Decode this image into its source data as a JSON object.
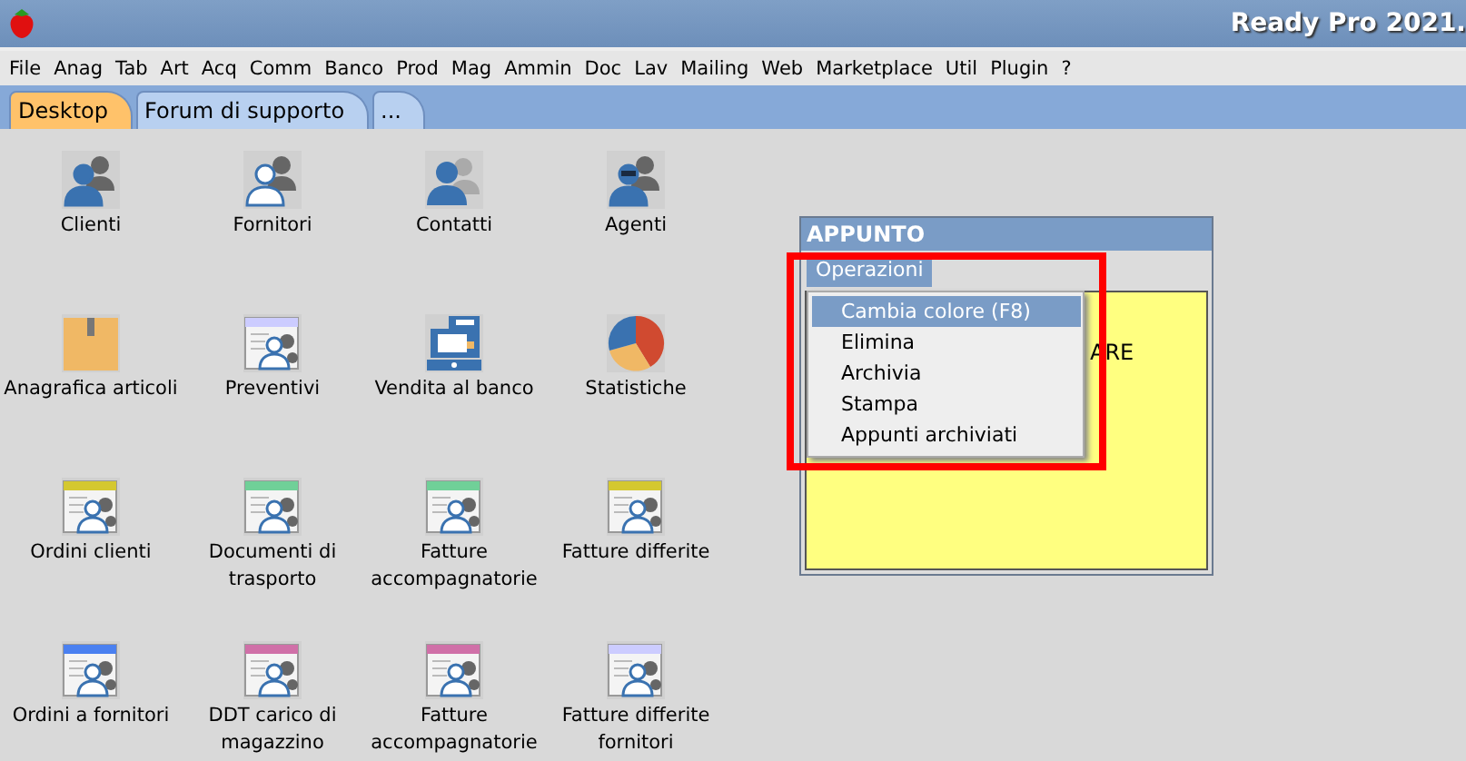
{
  "window": {
    "title": "Ready Pro 2021."
  },
  "menu": [
    "File",
    "Anag",
    "Tab",
    "Art",
    "Acq",
    "Comm",
    "Banco",
    "Prod",
    "Mag",
    "Ammin",
    "Doc",
    "Lav",
    "Mailing",
    "Web",
    "Marketplace",
    "Util",
    "Plugin",
    "?"
  ],
  "tabs": [
    {
      "label": "Desktop",
      "selected": true
    },
    {
      "label": "Forum di supporto",
      "selected": false
    },
    {
      "label": "...",
      "selected": false
    }
  ],
  "desktop_items": [
    {
      "label": "Clienti",
      "kind": "person"
    },
    {
      "label": "Fornitori",
      "kind": "person2"
    },
    {
      "label": "Contatti",
      "kind": "contact"
    },
    {
      "label": "Agenti",
      "kind": "agent"
    },
    {
      "label": "Anagrafica articoli",
      "kind": "box"
    },
    {
      "label": "Preventivi",
      "kind": "doc",
      "color": "#ccccff"
    },
    {
      "label": "Vendita al banco",
      "kind": "register"
    },
    {
      "label": "Statistiche",
      "kind": "pie"
    },
    {
      "label": "Ordini clienti",
      "kind": "doc",
      "color": "#d4c830"
    },
    {
      "label": "Documenti di trasporto",
      "kind": "doc",
      "color": "#70d098"
    },
    {
      "label": "Fatture accompagnatorie",
      "kind": "doc",
      "color": "#70d098"
    },
    {
      "label": "Fatture differite",
      "kind": "doc",
      "color": "#d4c830"
    },
    {
      "label": "Ordini a fornitori",
      "kind": "doc",
      "color": "#4a80f0"
    },
    {
      "label": "DDT carico di magazzino",
      "kind": "doc",
      "color": "#d070a8"
    },
    {
      "label": "Fatture accompagnatorie",
      "kind": "doc",
      "color": "#d070a8"
    },
    {
      "label": "Fatture differite fornitori",
      "kind": "doc",
      "color": "#ccccff"
    }
  ],
  "note": {
    "title": "APPUNTO",
    "menu_button": "Operazioni",
    "text": "ARE",
    "menu_items": [
      {
        "label": "Cambia colore (F8)",
        "selected": true
      },
      {
        "label": "Elimina",
        "selected": false
      },
      {
        "label": "Archivia",
        "selected": false
      },
      {
        "label": "Stampa",
        "selected": false
      },
      {
        "label": "Appunti archiviati",
        "selected": false
      }
    ]
  }
}
